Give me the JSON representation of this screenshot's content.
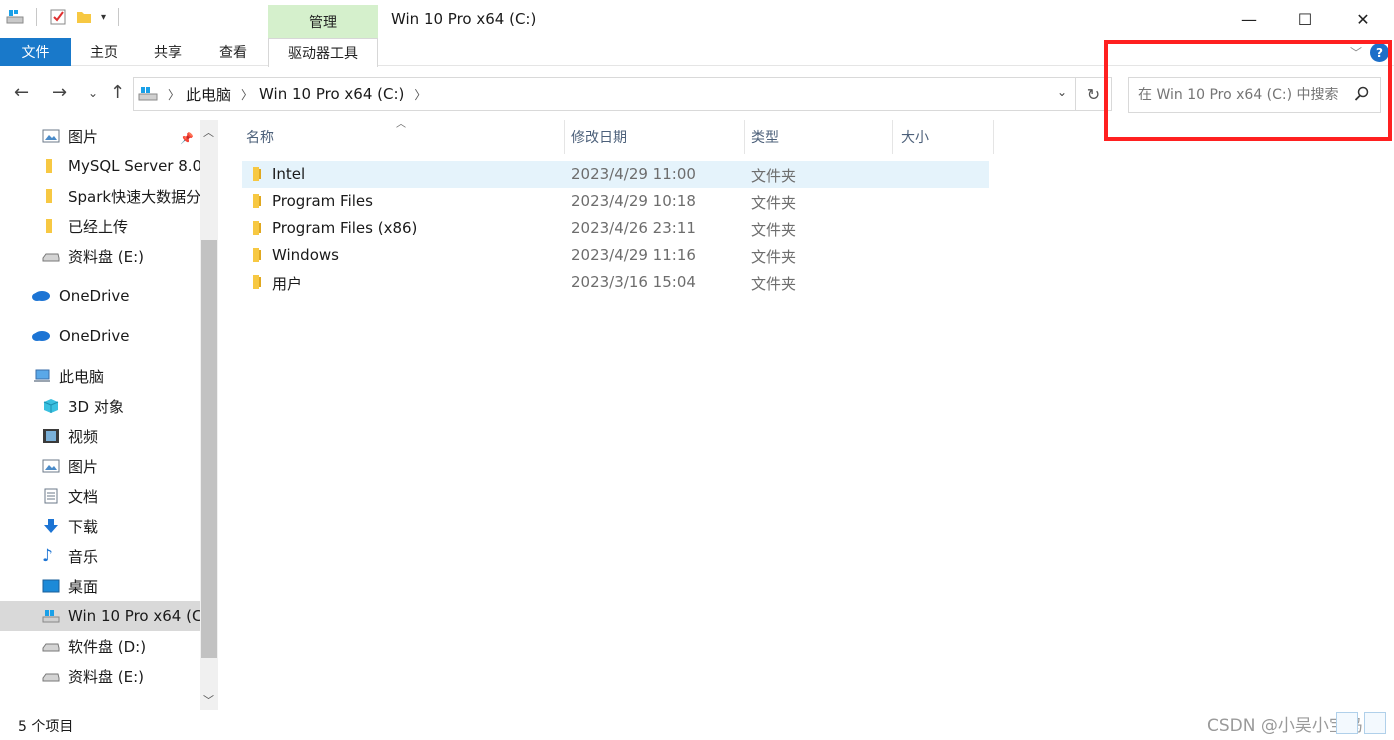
{
  "window": {
    "title": "Win 10 Pro x64 (C:)",
    "context_tab_group": "管理",
    "minimize": "—",
    "maximize": "☐",
    "close": "✕"
  },
  "ribbon": {
    "tabs": [
      "文件",
      "主页",
      "共享",
      "查看",
      "驱动器工具"
    ],
    "help": "?"
  },
  "address": {
    "segments": [
      "此电脑",
      "Win 10 Pro x64 (C:)"
    ]
  },
  "search": {
    "placeholder": "在 Win 10 Pro x64 (C:) 中搜索"
  },
  "nav_pane": {
    "items": [
      {
        "label": "图片",
        "icon": "pictures-icon",
        "pinned": true
      },
      {
        "label": "MySQL Server 8.0",
        "icon": "folder-icon"
      },
      {
        "label": "Spark快速大数据分",
        "icon": "folder-icon"
      },
      {
        "label": "已经上传",
        "icon": "folder-icon"
      },
      {
        "label": "资料盘 (E:)",
        "icon": "drive-icon"
      },
      {
        "label": "OneDrive",
        "icon": "onedrive-icon"
      },
      {
        "label": "OneDrive",
        "icon": "onedrive-icon"
      },
      {
        "label": "此电脑",
        "icon": "this-pc-icon"
      },
      {
        "label": "3D 对象",
        "icon": "3d-objects-icon"
      },
      {
        "label": "视频",
        "icon": "videos-icon"
      },
      {
        "label": "图片",
        "icon": "pictures-icon"
      },
      {
        "label": "文档",
        "icon": "documents-icon"
      },
      {
        "label": "下载",
        "icon": "downloads-icon"
      },
      {
        "label": "音乐",
        "icon": "music-icon"
      },
      {
        "label": "桌面",
        "icon": "desktop-icon"
      },
      {
        "label": "Win 10 Pro x64 (C:",
        "icon": "system-drive-icon",
        "selected": true
      },
      {
        "label": "软件盘 (D:)",
        "icon": "drive-icon"
      },
      {
        "label": "资料盘 (E:)",
        "icon": "drive-icon"
      }
    ]
  },
  "file_list": {
    "columns": [
      "名称",
      "修改日期",
      "类型",
      "大小"
    ],
    "rows": [
      {
        "name": "Intel",
        "modified": "2023/4/29 11:00",
        "type": "文件夹",
        "size": "",
        "selected": true
      },
      {
        "name": "Program Files",
        "modified": "2023/4/29 10:18",
        "type": "文件夹",
        "size": ""
      },
      {
        "name": "Program Files (x86)",
        "modified": "2023/4/26 23:11",
        "type": "文件夹",
        "size": ""
      },
      {
        "name": "Windows",
        "modified": "2023/4/29 11:16",
        "type": "文件夹",
        "size": ""
      },
      {
        "name": "用户",
        "modified": "2023/3/16 15:04",
        "type": "文件夹",
        "size": ""
      }
    ]
  },
  "status_bar": {
    "item_count": "5 个项目"
  },
  "watermark": "CSDN @小吴小宝鸟",
  "colors": {
    "file_tab": "#1979ca",
    "context_tab": "#d5f0cc",
    "selection": "#e5f3fb",
    "highlight_box": "#ff2020"
  }
}
